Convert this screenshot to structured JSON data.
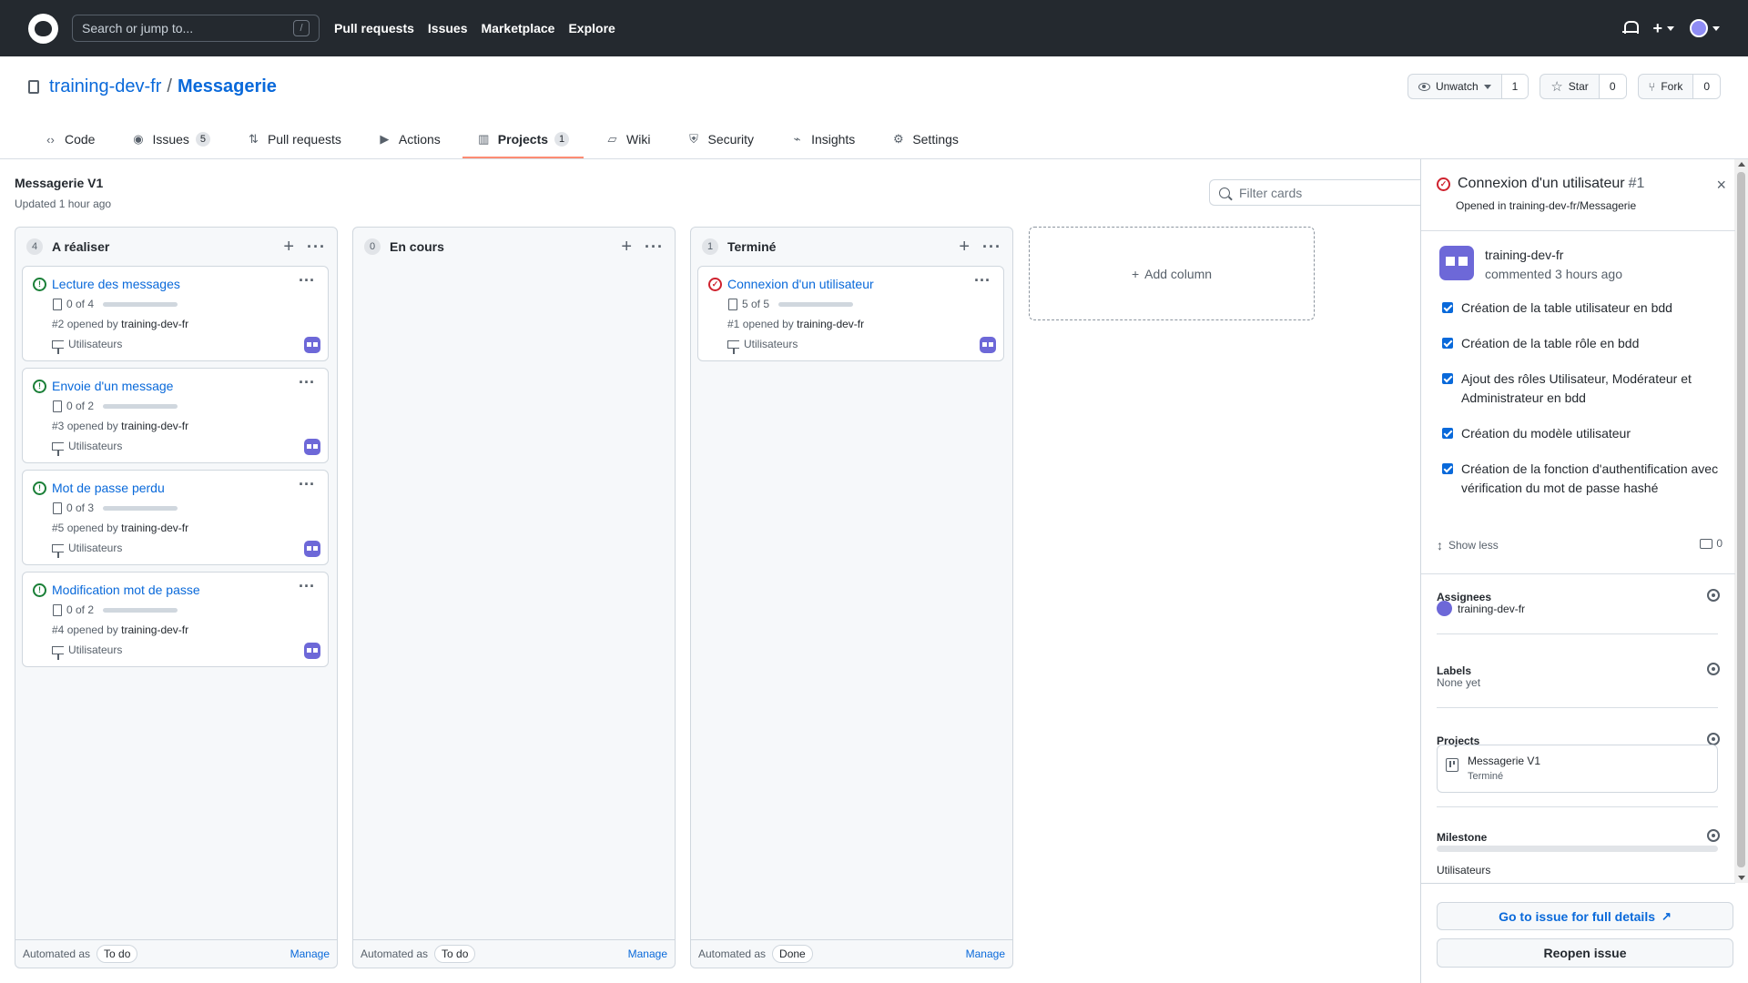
{
  "header": {
    "search_placeholder": "Search or jump to...",
    "search_shortcut": "/",
    "nav": [
      "Pull requests",
      "Issues",
      "Marketplace",
      "Explore"
    ],
    "plus": "+"
  },
  "repo": {
    "owner": "training-dev-fr",
    "separator": "/",
    "name": "Messagerie",
    "actions": [
      {
        "label": "Unwatch",
        "count": "1"
      },
      {
        "label": "Star",
        "count": "0"
      },
      {
        "label": "Fork",
        "count": "0"
      }
    ]
  },
  "tabs": [
    {
      "label": "Code",
      "icon": "code-icon"
    },
    {
      "label": "Issues",
      "count": "5",
      "icon": "issue-icon"
    },
    {
      "label": "Pull requests",
      "icon": "pull-request-icon"
    },
    {
      "label": "Actions",
      "icon": "play-icon"
    },
    {
      "label": "Projects",
      "count": "1",
      "icon": "project-icon",
      "active": true
    },
    {
      "label": "Wiki",
      "icon": "book-icon"
    },
    {
      "label": "Security",
      "icon": "shield-icon"
    },
    {
      "label": "Insights",
      "icon": "graph-icon"
    },
    {
      "label": "Settings",
      "icon": "gear-icon"
    }
  ],
  "project": {
    "title": "Messagerie V1",
    "updated": "Updated 1 hour ago",
    "filter_placeholder": "Filter cards",
    "add_column": "Add column"
  },
  "columns": [
    {
      "count": "4",
      "name": "A réaliser",
      "plus": "+",
      "dots": "···",
      "automated_label": "Automated as",
      "automated_value": "To do",
      "manage": "Manage",
      "cards": [
        {
          "title": "Lecture des messages",
          "progress_text": "0 of 4",
          "progress": 0,
          "number": "#2",
          "opened": "opened by",
          "user": "training-dev-fr",
          "milestone": "Utilisateurs",
          "state": "open",
          "dots": "···"
        },
        {
          "title": "Envoie d'un message",
          "progress_text": "0 of 2",
          "progress": 0,
          "number": "#3",
          "opened": "opened by",
          "user": "training-dev-fr",
          "milestone": "Utilisateurs",
          "state": "open",
          "dots": "···"
        },
        {
          "title": "Mot de passe perdu",
          "progress_text": "0 of 3",
          "progress": 0,
          "number": "#5",
          "opened": "opened by",
          "user": "training-dev-fr",
          "milestone": "Utilisateurs",
          "state": "open",
          "dots": "···"
        },
        {
          "title": "Modification mot de passe",
          "progress_text": "0 of 2",
          "progress": 0,
          "number": "#4",
          "opened": "opened by",
          "user": "training-dev-fr",
          "milestone": "Utilisateurs",
          "state": "open",
          "dots": "···"
        }
      ]
    },
    {
      "count": "0",
      "name": "En cours",
      "plus": "+",
      "dots": "···",
      "automated_label": "Automated as",
      "automated_value": "To do",
      "manage": "Manage",
      "cards": []
    },
    {
      "count": "1",
      "name": "Terminé",
      "plus": "+",
      "dots": "···",
      "automated_label": "Automated as",
      "automated_value": "Done",
      "manage": "Manage",
      "cards": [
        {
          "title": "Connexion d'un utilisateur",
          "progress_text": "5 of 5",
          "progress": 100,
          "number": "#1",
          "opened": "opened by",
          "user": "training-dev-fr",
          "milestone": "Utilisateurs",
          "state": "closed",
          "dots": "···"
        }
      ]
    }
  ],
  "panel": {
    "title": "Connexion d'un utilisateur",
    "number": "#1",
    "close": "×",
    "opened_prefix": "Opened in",
    "opened_repo": "training-dev-fr/Messagerie",
    "commenter": "training-dev-fr",
    "comment_time": "commented 3 hours ago",
    "checklist": [
      "Création de la table utilisateur en bdd",
      "Création de la table rôle en bdd",
      "Ajout des rôles Utilisateur, Modérateur et Administrateur en bdd",
      "Création du modèle utilisateur",
      "Création de la fonction d'authentification avec vérification du mot de passe hashé"
    ],
    "show_less": "Show less",
    "comment_count": "0",
    "assignees_label": "Assignees",
    "assignee": "training-dev-fr",
    "labels_label": "Labels",
    "labels_value": "None yet",
    "projects_label": "Projects",
    "project_name": "Messagerie V1",
    "project_status": "Terminé",
    "milestone_label": "Milestone",
    "milestone_value": "Utilisateurs",
    "full_details": "Go to issue for full details",
    "reopen": "Reopen issue"
  },
  "colors": {
    "header_bg": "#24292f",
    "link": "#0969da",
    "open_issue": "#1a7f37",
    "closed_issue": "#cf222e",
    "active_tab": "#fd8c73"
  }
}
